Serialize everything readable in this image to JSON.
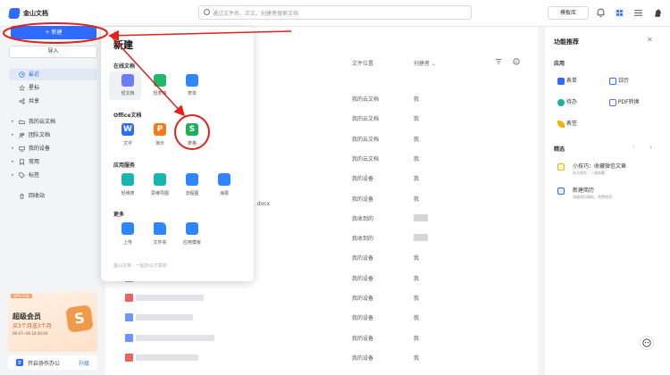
{
  "app": {
    "title": "金山文档"
  },
  "search": {
    "placeholder": "通过文件名、正文、创建者搜索文档"
  },
  "header": {
    "template_label": "模板库"
  },
  "sidebar": {
    "new_label": "+ 新建",
    "import_label": "导入",
    "items": [
      {
        "label": "最近"
      },
      {
        "label": "星标"
      },
      {
        "label": "共享"
      },
      {
        "label": "我的云文档"
      },
      {
        "label": "团队文档"
      },
      {
        "label": "我的设备"
      },
      {
        "label": "常用"
      },
      {
        "label": "标签"
      },
      {
        "label": "回收站"
      }
    ],
    "promo": {
      "tag": "WPS 618",
      "title": "超级会员",
      "subtitle": "买3个月送3个月",
      "time": "06-07~06-18 00:00",
      "badge": "S",
      "bar_text": "开启协作办公",
      "upgrade": "升级"
    }
  },
  "dropdown": {
    "title": "新建",
    "sections": [
      {
        "label": "在线文档",
        "items": [
          "轻文档",
          "轻表格",
          "表单"
        ]
      },
      {
        "label": "Office文档",
        "items": [
          "文字",
          "演示",
          "表格"
        ]
      },
      {
        "label": "应用服务",
        "items": [
          "轻维表",
          "思维导图",
          "流程图",
          "海报"
        ]
      },
      {
        "label": "更多",
        "items": [
          "上传",
          "文件夹",
          "应用模板"
        ]
      }
    ],
    "footer": "金山文档 · 一起办公才高效"
  },
  "main": {
    "columns": {
      "location": "文件位置",
      "creator": "创建者"
    },
    "docx_fragment": ".docx",
    "rows": [
      {
        "location": "我的云文档",
        "creator": "我"
      },
      {
        "location": "我的云文档",
        "creator": "我"
      },
      {
        "location": "我的云文档",
        "creator": "我"
      },
      {
        "location": "我的云文档",
        "creator": "我"
      },
      {
        "location": "我的设备",
        "creator": "我"
      },
      {
        "location": "我的设备",
        "creator": "我"
      },
      {
        "location": "我收到的",
        "creator": ""
      },
      {
        "location": "我收到的",
        "creator": ""
      },
      {
        "location": "我的设备",
        "creator": "我"
      },
      {
        "location": "我的设备",
        "creator": "我"
      },
      {
        "location": "我的设备",
        "creator": "我"
      },
      {
        "location": "我的设备",
        "creator": "我"
      },
      {
        "location": "我的设备",
        "creator": "我"
      },
      {
        "location": "我的设备",
        "creator": "我"
      }
    ]
  },
  "right_panel": {
    "title": "功能推荐",
    "section1": "应用",
    "apps": [
      "表单",
      "日历",
      "待办",
      "PDF转换",
      "表签"
    ],
    "section2": "精选",
    "picks": [
      {
        "title": "小技巧：收藏微信文章",
        "sub": "永久保存，一键收藏"
      },
      {
        "title": "新建简历",
        "sub": "海量简历模板，免费使用"
      }
    ]
  },
  "colors": {
    "accent": "#2f6bff",
    "annotation": "#e3211c"
  }
}
